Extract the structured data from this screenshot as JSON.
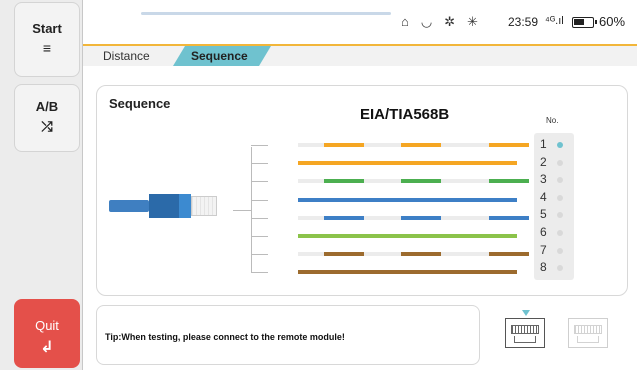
{
  "sidebar": {
    "start": {
      "label": "Start",
      "icon": "≡"
    },
    "ab": {
      "label": "A/B",
      "icon": "⤮"
    },
    "quit": {
      "label": "Quit",
      "icon": "↲"
    }
  },
  "status": {
    "icons": "🔓 ◎ ✸ ✳",
    "time": "23:59",
    "signal": "⁴ᴳ.ıl",
    "battery_text": "60%",
    "battery_level": 0.6
  },
  "tabs": [
    {
      "label": "Distance",
      "active": false
    },
    {
      "label": "Sequence",
      "active": true
    }
  ],
  "panel": {
    "title": "Sequence",
    "standard": "EIA/TIA568B",
    "no_label": "No."
  },
  "wires": [
    {
      "pin": "1",
      "color": "#f5a623",
      "striped": true,
      "active": true
    },
    {
      "pin": "2",
      "color": "#f5a623",
      "striped": false,
      "active": false
    },
    {
      "pin": "3",
      "color": "#4caf50",
      "striped": true,
      "active": false
    },
    {
      "pin": "4",
      "color": "#3d7fc6",
      "striped": false,
      "active": false
    },
    {
      "pin": "5",
      "color": "#3d7fc6",
      "striped": true,
      "active": false
    },
    {
      "pin": "6",
      "color": "#8bc34a",
      "striped": false,
      "active": false
    },
    {
      "pin": "7",
      "color": "#9c6b2e",
      "striped": true,
      "active": false
    },
    {
      "pin": "8",
      "color": "#9c6b2e",
      "striped": false,
      "active": false
    }
  ],
  "tip": "Tip:When testing, please connect to the remote module!",
  "colors": {
    "accent": "#6fc2cf",
    "quit": "#e4504a",
    "tab_border": "#f2b63a"
  }
}
